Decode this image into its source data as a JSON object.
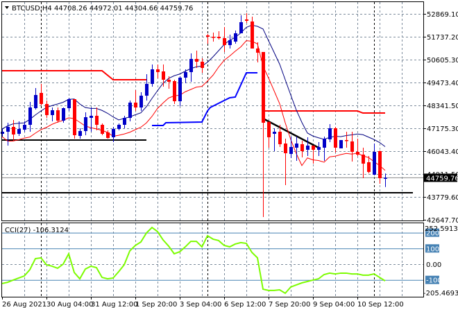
{
  "header": {
    "symbol": "BTCUSD,H4",
    "ohlc": "44708.26 44972.01 44304.66 44759.76"
  },
  "indicator": {
    "label": "CCI(27) -106.3124",
    "scale_max": "252.5913",
    "scale_min": "-205.4693",
    "levels": [
      {
        "label": "200",
        "value": 200,
        "boxed": true
      },
      {
        "label": "100",
        "value": 100,
        "boxed": true
      },
      {
        "label": "0.00",
        "value": 0,
        "boxed": false
      },
      {
        "label": "-100",
        "value": -100,
        "boxed": true
      }
    ]
  },
  "price_axis": {
    "labels": [
      "52869.10",
      "51737.20",
      "50605.30",
      "49473.40",
      "48341.50",
      "47175.30",
      "46043.40",
      "44911.50",
      "43779.60",
      "42647.70"
    ],
    "current_price": "44759.76"
  },
  "time_axis": {
    "labels": [
      "26 Aug 2021",
      "30 Aug 04:00",
      "31 Aug 12:00",
      "1 Sep 20:00",
      "3 Sep 04:00",
      "6 Sep 12:00",
      "7 Sep 20:00",
      "9 Sep 04:00",
      "10 Sep 12:00"
    ]
  },
  "colors": {
    "bull": "#0000c8",
    "bear": "#ff0000",
    "ma_fast": "#ff0000",
    "ma_slow": "#000080",
    "cci": "#7cfc00",
    "level": "#4682b4",
    "grid": "#7b8a9b"
  },
  "chart_data": {
    "type": "candlestick",
    "title": "BTCUSD,H4",
    "ylim": [
      42647.7,
      53200
    ],
    "candles_ohlc": [
      [
        46935,
        47175,
        46798,
        47038
      ],
      [
        47038,
        47484,
        46352,
        47278
      ],
      [
        47278,
        47621,
        46592,
        46901
      ],
      [
        46935,
        47553,
        46832,
        47175
      ],
      [
        47141,
        47553,
        47038,
        47381
      ],
      [
        47381,
        48513,
        47038,
        48238
      ],
      [
        48204,
        49199,
        48136,
        48856
      ],
      [
        48959,
        49405,
        48341,
        48410
      ],
      [
        48410,
        48582,
        47724,
        47861
      ],
      [
        47861,
        48238,
        47553,
        48101
      ],
      [
        48101,
        48238,
        47484,
        47587
      ],
      [
        47587,
        48238,
        47484,
        48204
      ],
      [
        48204,
        48719,
        48067,
        48650
      ],
      [
        48650,
        48650,
        46695,
        46867
      ],
      [
        46832,
        47210,
        46695,
        47072
      ],
      [
        47072,
        47999,
        46867,
        47758
      ],
      [
        47724,
        48238,
        47038,
        47827
      ],
      [
        47827,
        48238,
        47107,
        47381
      ],
      [
        47381,
        47450,
        46867,
        46935
      ],
      [
        47004,
        47107,
        46695,
        46729
      ],
      [
        46764,
        47278,
        46523,
        47175
      ],
      [
        47175,
        47450,
        47107,
        47381
      ],
      [
        47381,
        47827,
        47210,
        47724
      ],
      [
        47724,
        48582,
        47553,
        48479
      ],
      [
        48479,
        49096,
        48067,
        48238
      ],
      [
        48238,
        48993,
        48067,
        48822
      ],
      [
        48822,
        49885,
        48582,
        49405
      ],
      [
        49405,
        50365,
        49268,
        50125
      ],
      [
        50125,
        50365,
        49679,
        49988
      ],
      [
        50022,
        50365,
        49268,
        49611
      ],
      [
        49611,
        49782,
        49165,
        49508
      ],
      [
        49542,
        49611,
        48410,
        48547
      ],
      [
        48547,
        49782,
        48307,
        49714
      ],
      [
        49714,
        50125,
        49439,
        49988
      ],
      [
        49988,
        50914,
        49508,
        50639
      ],
      [
        50639,
        51051,
        50194,
        50502
      ],
      [
        50502,
        50674,
        49954,
        50194
      ],
      [
        51806,
        51874,
        51394,
        51737
      ],
      [
        51737,
        51943,
        51497,
        51703
      ],
      [
        51737,
        52011,
        51600,
        51669
      ],
      [
        51669,
        52217,
        50983,
        51325
      ],
      [
        51325,
        51840,
        51154,
        51566
      ],
      [
        51497,
        52046,
        51394,
        51909
      ],
      [
        51909,
        52800,
        51909,
        52457
      ],
      [
        52594,
        52903,
        52423,
        52526
      ],
      [
        52492,
        52732,
        51154,
        51154
      ],
      [
        51154,
        51463,
        50468,
        50948
      ],
      [
        50983,
        50983,
        42819,
        47484
      ],
      [
        47518,
        47553,
        46249,
        46764
      ],
      [
        46935,
        47210,
        46078,
        47038
      ],
      [
        47038,
        47381,
        46283,
        46421
      ],
      [
        46455,
        46695,
        44397,
        45975
      ],
      [
        45940,
        46798,
        45735,
        46283
      ],
      [
        46249,
        46798,
        45598,
        46455
      ],
      [
        46421,
        46592,
        45769,
        46078
      ],
      [
        46146,
        46764,
        45838,
        46352
      ],
      [
        46352,
        46352,
        45460,
        46146
      ],
      [
        46146,
        46523,
        45838,
        46283
      ],
      [
        46249,
        46798,
        45598,
        46695
      ],
      [
        46661,
        47416,
        46523,
        47210
      ],
      [
        47210,
        47278,
        46009,
        46249
      ],
      [
        46215,
        46626,
        46215,
        46626
      ],
      [
        46626,
        47038,
        46249,
        46592
      ],
      [
        46558,
        47038,
        45563,
        46043
      ],
      [
        46043,
        46695,
        45838,
        45906
      ],
      [
        45906,
        46249,
        44740,
        45460
      ],
      [
        45529,
        45838,
        44980,
        45049
      ],
      [
        44912,
        46455,
        44877,
        46043
      ],
      [
        46078,
        46112,
        44466,
        44740
      ],
      [
        44708.26,
        44972.01,
        44304.66,
        44759.76
      ]
    ],
    "resistance_line": [
      [
        [
          0,
          50057
        ],
        [
          18,
          50057
        ],
        [
          20,
          49611
        ],
        [
          26,
          49611
        ]
      ],
      [
        [
          47,
          48067
        ],
        [
          64,
          48067
        ],
        [
          65,
          47964
        ],
        [
          69,
          47964
        ]
      ]
    ],
    "support_stop_line": [
      [
        27,
        47347
      ],
      [
        29,
        47347
      ],
      [
        29.5,
        47484
      ],
      [
        36,
        47518
      ],
      [
        37,
        48067
      ],
      [
        37.5,
        48238
      ],
      [
        41,
        48719
      ],
      [
        42,
        48753
      ],
      [
        44,
        49954
      ],
      [
        46,
        49954
      ]
    ],
    "horizontal_levels": [
      {
        "price": 46626,
        "from_bar": 0,
        "to_bar": 26
      },
      {
        "price": 44020,
        "from_bar": 0,
        "to_bar": 74
      }
    ],
    "trendline": [
      [
        47.25,
        47655
      ],
      [
        57,
        46249
      ]
    ],
    "cci_period": 27,
    "cci_values": [
      -123,
      -115,
      -101,
      -88,
      -75,
      -35,
      35,
      40,
      -4,
      -13,
      -26,
      0,
      66,
      -53,
      -93,
      -31,
      -13,
      -22,
      -84,
      -93,
      -88,
      -48,
      -4,
      84,
      119,
      141,
      198,
      233,
      207,
      154,
      115,
      66,
      79,
      110,
      145,
      145,
      110,
      181,
      159,
      150,
      119,
      110,
      128,
      137,
      132,
      75,
      40,
      -159,
      -167,
      -167,
      -163,
      -185,
      -145,
      -132,
      -119,
      -110,
      -101,
      -93,
      -66,
      -57,
      -62,
      -57,
      -57,
      -62,
      -62,
      -70,
      -70,
      -62,
      -84,
      -106.3124
    ],
    "cci_ylim": [
      -205.4693,
      252.5913
    ]
  }
}
